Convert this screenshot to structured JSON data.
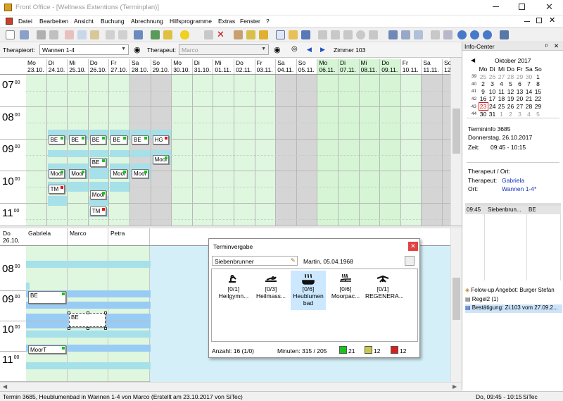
{
  "window": {
    "title": "Front Office - [Wellness Extentions (Terminplan)]"
  },
  "menu": [
    "Datei",
    "Bearbeiten",
    "Ansicht",
    "Buchung",
    "Abrechnung",
    "Hilfsprogramme",
    "Extras",
    "Fenster",
    "?"
  ],
  "filter": {
    "therapieort_label": "Therapieort:",
    "therapieort_value": "Wannen 1-4",
    "therapeut_label": "Therapeut:",
    "therapeut_value": "Marco",
    "room": "Zimmer 103"
  },
  "week_days": [
    {
      "d": "Mo",
      "n": "23.10.",
      "type": "work"
    },
    {
      "d": "Di",
      "n": "24.10.",
      "type": "work"
    },
    {
      "d": "Mi",
      "n": "25.10.",
      "type": "work"
    },
    {
      "d": "Do",
      "n": "26.10.",
      "type": "work"
    },
    {
      "d": "Fr",
      "n": "27.10.",
      "type": "work"
    },
    {
      "d": "Sa",
      "n": "28.10.",
      "type": "weekend"
    },
    {
      "d": "So",
      "n": "29.10.",
      "type": "weekend"
    },
    {
      "d": "Mo",
      "n": "30.10.",
      "type": "work"
    },
    {
      "d": "Di",
      "n": "31.10.",
      "type": "work"
    },
    {
      "d": "Mi",
      "n": "01.11.",
      "type": "work"
    },
    {
      "d": "Do",
      "n": "02.11.",
      "type": "work"
    },
    {
      "d": "Fr",
      "n": "03.11.",
      "type": "work"
    },
    {
      "d": "Sa",
      "n": "04.11.",
      "type": "weekend"
    },
    {
      "d": "So",
      "n": "05.11.",
      "type": "weekend"
    },
    {
      "d": "Mo",
      "n": "06.11.",
      "type": "selected"
    },
    {
      "d": "Di",
      "n": "07.11.",
      "type": "selected"
    },
    {
      "d": "Mi",
      "n": "08.11.",
      "type": "selected"
    },
    {
      "d": "Do",
      "n": "09.11.",
      "type": "selected"
    },
    {
      "d": "Fr",
      "n": "10.11.",
      "type": "work"
    },
    {
      "d": "Sa",
      "n": "11.11.",
      "type": "weekend"
    },
    {
      "d": "So",
      "n": "12.11.",
      "type": "weekend"
    }
  ],
  "week_hours": [
    "07",
    "08",
    "09",
    "10",
    "11"
  ],
  "week_appts": [
    {
      "day": 1,
      "slot": 0,
      "label": "BE",
      "flag": "green"
    },
    {
      "day": 2,
      "slot": 0,
      "label": "BE",
      "flag": "green"
    },
    {
      "day": 3,
      "slot": 0,
      "label": "BE",
      "flag": "green"
    },
    {
      "day": 4,
      "slot": 0,
      "label": "BE",
      "flag": "green"
    },
    {
      "day": 5,
      "slot": 0,
      "label": "BE",
      "flag": "green"
    },
    {
      "day": 6,
      "slot": 0,
      "label": "HG",
      "flag": "red"
    },
    {
      "day": 3,
      "slot": 1,
      "label": "BE",
      "flag": "green"
    },
    {
      "day": 6,
      "slot": 2,
      "label": "Moor",
      "flag": "green"
    },
    {
      "day": 1,
      "slot": 3,
      "label": "Moor",
      "flag": "green"
    },
    {
      "day": 2,
      "slot": 3,
      "label": "Moor",
      "flag": "green"
    },
    {
      "day": 4,
      "slot": 3,
      "label": "Moor",
      "flag": "green"
    },
    {
      "day": 5,
      "slot": 3,
      "label": "Moor",
      "flag": "green"
    },
    {
      "day": 1,
      "slot": 4,
      "label": "TM",
      "flag": "red"
    },
    {
      "day": 3,
      "slot": 5,
      "label": "Moor",
      "flag": "green"
    },
    {
      "day": 3,
      "slot": 6,
      "label": "TM",
      "flag": "red"
    }
  ],
  "day_view": {
    "day": "Do",
    "date": "26.10.",
    "therapists": [
      "Gabriela",
      "Marco",
      "Petra"
    ],
    "hours": [
      "08",
      "09",
      "10",
      "11"
    ],
    "appts": [
      {
        "col": 0,
        "label": "BE",
        "flag": "green"
      },
      {
        "col": 1,
        "label": "BE",
        "flag": "none"
      },
      {
        "col": 0,
        "label": "MoorT",
        "flag": "green"
      }
    ]
  },
  "info": {
    "title": "Info-Center",
    "month": "Oktober 2017",
    "weekdays": [
      "Mo",
      "Di",
      "Mi",
      "Do",
      "Fr",
      "Sa",
      "So"
    ],
    "weeks": [
      [
        "39",
        [
          "25",
          "26",
          "27",
          "28",
          "29",
          "30",
          "1"
        ]
      ],
      [
        "40",
        [
          "2",
          "3",
          "4",
          "5",
          "6",
          "7",
          "8"
        ]
      ],
      [
        "41",
        [
          "9",
          "10",
          "11",
          "12",
          "13",
          "14",
          "15"
        ]
      ],
      [
        "42",
        [
          "16",
          "17",
          "18",
          "19",
          "20",
          "21",
          "22"
        ]
      ],
      [
        "43",
        [
          "23",
          "24",
          "25",
          "26",
          "27",
          "28",
          "29"
        ]
      ],
      [
        "44",
        [
          "30",
          "31",
          "1",
          "2",
          "3",
          "4",
          "5"
        ]
      ]
    ],
    "today": "23",
    "termininfo": "Termininfo 3685",
    "termin_date": "Donnerstag, 26.10.2017",
    "zeit_label": "Zeit:",
    "zeit": "09:45 - 10:15",
    "therapeut_ort": "Therapeut / Ort:",
    "therapeut_label": "Therapeut:",
    "therapeut": "Gabriela",
    "ort_label": "Ort:",
    "ort": "Wannen 1-4*",
    "grid_row": [
      "09:45",
      "Siebenbrun...",
      "BE"
    ],
    "messages": [
      "Folow-up Angebot: Burger Stefan",
      "Regel2 (1)",
      "Bestätigung: Zi.103 vom 27.09.2..."
    ]
  },
  "dialog": {
    "title": "Terminvergabe",
    "guest": "Siebenbrunner",
    "guest_info": "Martin, 05.04.1968",
    "treatments": [
      {
        "count": "[0/1]",
        "name": "Heilgymn...",
        "icon": "gym"
      },
      {
        "count": "[0/3]",
        "name": "Heilmass...",
        "icon": "massage"
      },
      {
        "count": "[0/6]",
        "name": "Heublumen bad",
        "icon": "bath",
        "selected": true
      },
      {
        "count": "[0/6]",
        "name": "Moorpac...",
        "icon": "mud"
      },
      {
        "count": "[0/1]",
        "name": "REGENERA...",
        "icon": "regen"
      }
    ],
    "anzahl": "Anzahl: 16 (1/0)",
    "minuten": "Minuten: 315 / 205",
    "c1": "21",
    "c2": "12",
    "c3": "12",
    "green": "#19c419",
    "olive": "#c8c84a",
    "red": "#d81e1e"
  },
  "status": {
    "left": "Termin 3685, Heublumenbad in Wannen 1-4 von Marco (Erstellt am 23.10.2017 von SiTec)",
    "right": "Do, 09:45 - 10:15",
    "user": "SiTec"
  },
  "colors": {
    "grid_green": "#dff6df",
    "weekend": "#d5d5d5",
    "cyan": "#a6e0e8",
    "blue": "#99ccf5",
    "selected_day": "#d5f5d5"
  }
}
